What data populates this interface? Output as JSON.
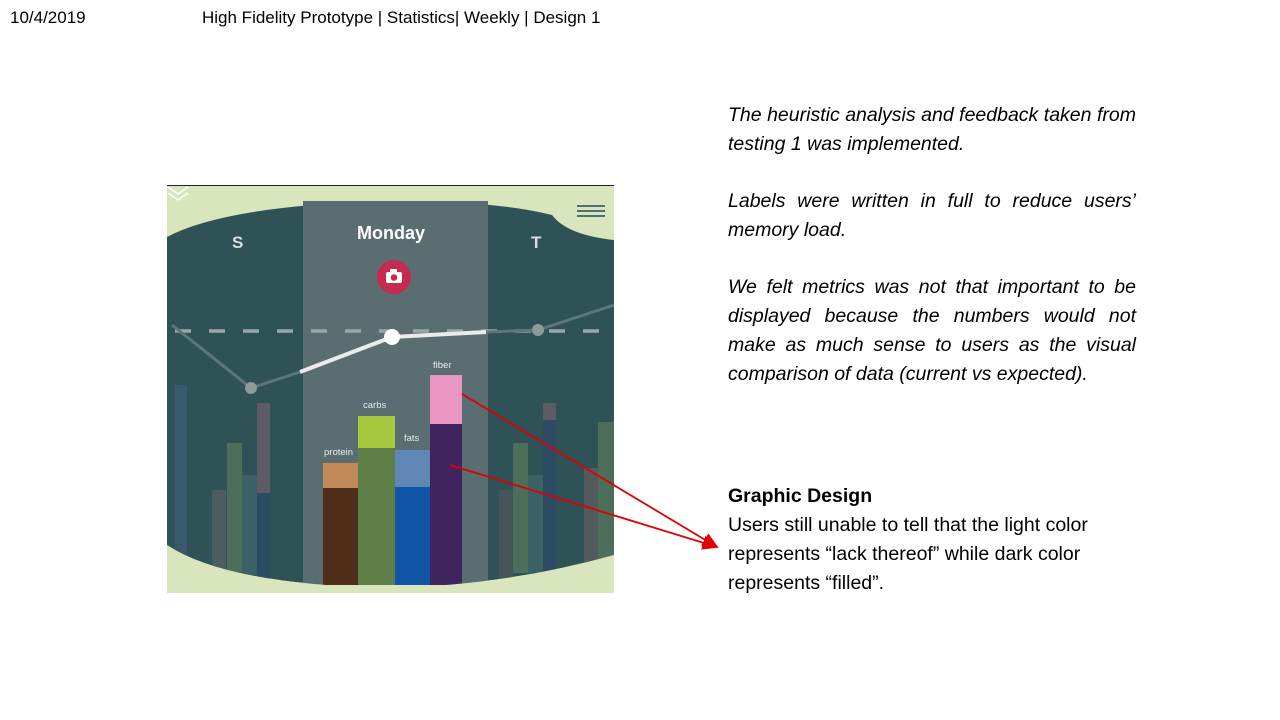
{
  "header": {
    "date": "10/4/2019",
    "title": "High Fidelity Prototype | Statistics| Weekly | Design 1"
  },
  "mockup": {
    "days": {
      "left": "S",
      "current": "Monday",
      "right": "T"
    },
    "bars": [
      {
        "label": "protein",
        "filled_color": "#4e2e18",
        "lack_color": "#c18a58"
      },
      {
        "label": "carbs",
        "filled_color": "#5f7f49",
        "lack_color": "#a5c840"
      },
      {
        "label": "fats",
        "filled_color": "#1155a6",
        "lack_color": "#5f88b6"
      },
      {
        "label": "fiber",
        "filled_color": "#3f2460",
        "lack_color": "#ea96c3"
      }
    ],
    "icons": {
      "menu": "menu-icon",
      "camera": "camera-icon",
      "chevron": "chevron-down-icon"
    },
    "colors": {
      "background": "#2f5256",
      "highlight_column": "#5a6d70",
      "frame": "#d8e5bd"
    }
  },
  "notes": {
    "p1": "The heuristic analysis and feedback taken from testing 1 was implemented.",
    "p2": "Labels were written in full to reduce users’ memory load.",
    "p3": "We felt metrics was not that important to be displayed because the numbers would not make as much sense to users as the visual comparison of data (current vs expected)."
  },
  "graphic_design": {
    "title": "Graphic Design",
    "body": "Users still unable to tell that the light color represents “lack thereof” while dark color represents “filled”."
  },
  "annotation_color": "#e00000"
}
